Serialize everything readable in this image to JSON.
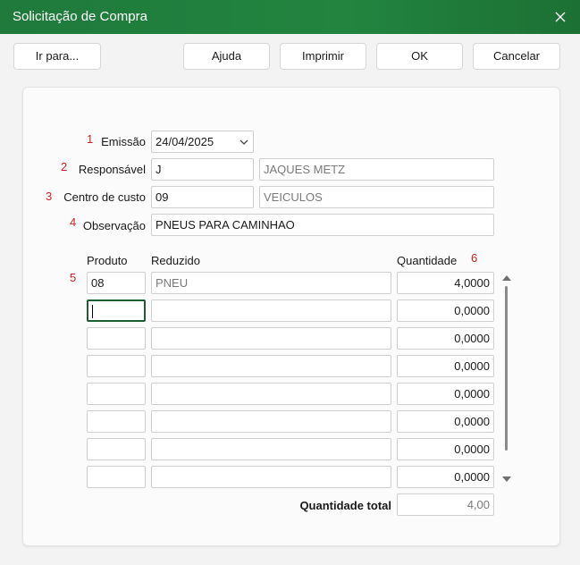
{
  "window": {
    "title": "Solicitação de Compra"
  },
  "toolbar": {
    "goto_label": "Ir para...",
    "help_label": "Ajuda",
    "print_label": "Imprimir",
    "ok_label": "OK",
    "cancel_label": "Cancelar"
  },
  "form": {
    "emissao": {
      "marker": "1",
      "label": "Emissão",
      "value": "24/04/2025"
    },
    "responsavel": {
      "marker": "2",
      "label": "Responsável",
      "code": "J",
      "name": "JAQUES METZ"
    },
    "centro_custo": {
      "marker": "3",
      "label": "Centro de custo",
      "code": "09",
      "name": "VEICULOS"
    },
    "observacao": {
      "marker": "4",
      "label": "Observação",
      "value": "PNEUS PARA CAMINHAO"
    }
  },
  "grid": {
    "produto_marker": "5",
    "quantidade_marker": "6",
    "headers": {
      "produto": "Produto",
      "reduzido": "Reduzido",
      "quantidade": "Quantidade"
    },
    "rows": [
      {
        "produto": "08",
        "reduzido": "PNEU",
        "quantidade": "4,0000"
      },
      {
        "produto": "",
        "reduzido": "",
        "quantidade": "0,0000"
      },
      {
        "produto": "",
        "reduzido": "",
        "quantidade": "0,0000"
      },
      {
        "produto": "",
        "reduzido": "",
        "quantidade": "0,0000"
      },
      {
        "produto": "",
        "reduzido": "",
        "quantidade": "0,0000"
      },
      {
        "produto": "",
        "reduzido": "",
        "quantidade": "0,0000"
      },
      {
        "produto": "",
        "reduzido": "",
        "quantidade": "0,0000"
      },
      {
        "produto": "",
        "reduzido": "",
        "quantidade": "0,0000"
      }
    ],
    "total_label": "Quantidade total",
    "total_value": "4,00"
  },
  "icons": {
    "close": "close-icon",
    "dropdown": "chevron-down-icon",
    "scroll_up": "triangle-up-icon",
    "scroll_down": "triangle-down-icon"
  },
  "colors": {
    "titlebar": "#1f7a3c",
    "marker": "#d21e1e",
    "focus_border": "#1b5e32"
  }
}
